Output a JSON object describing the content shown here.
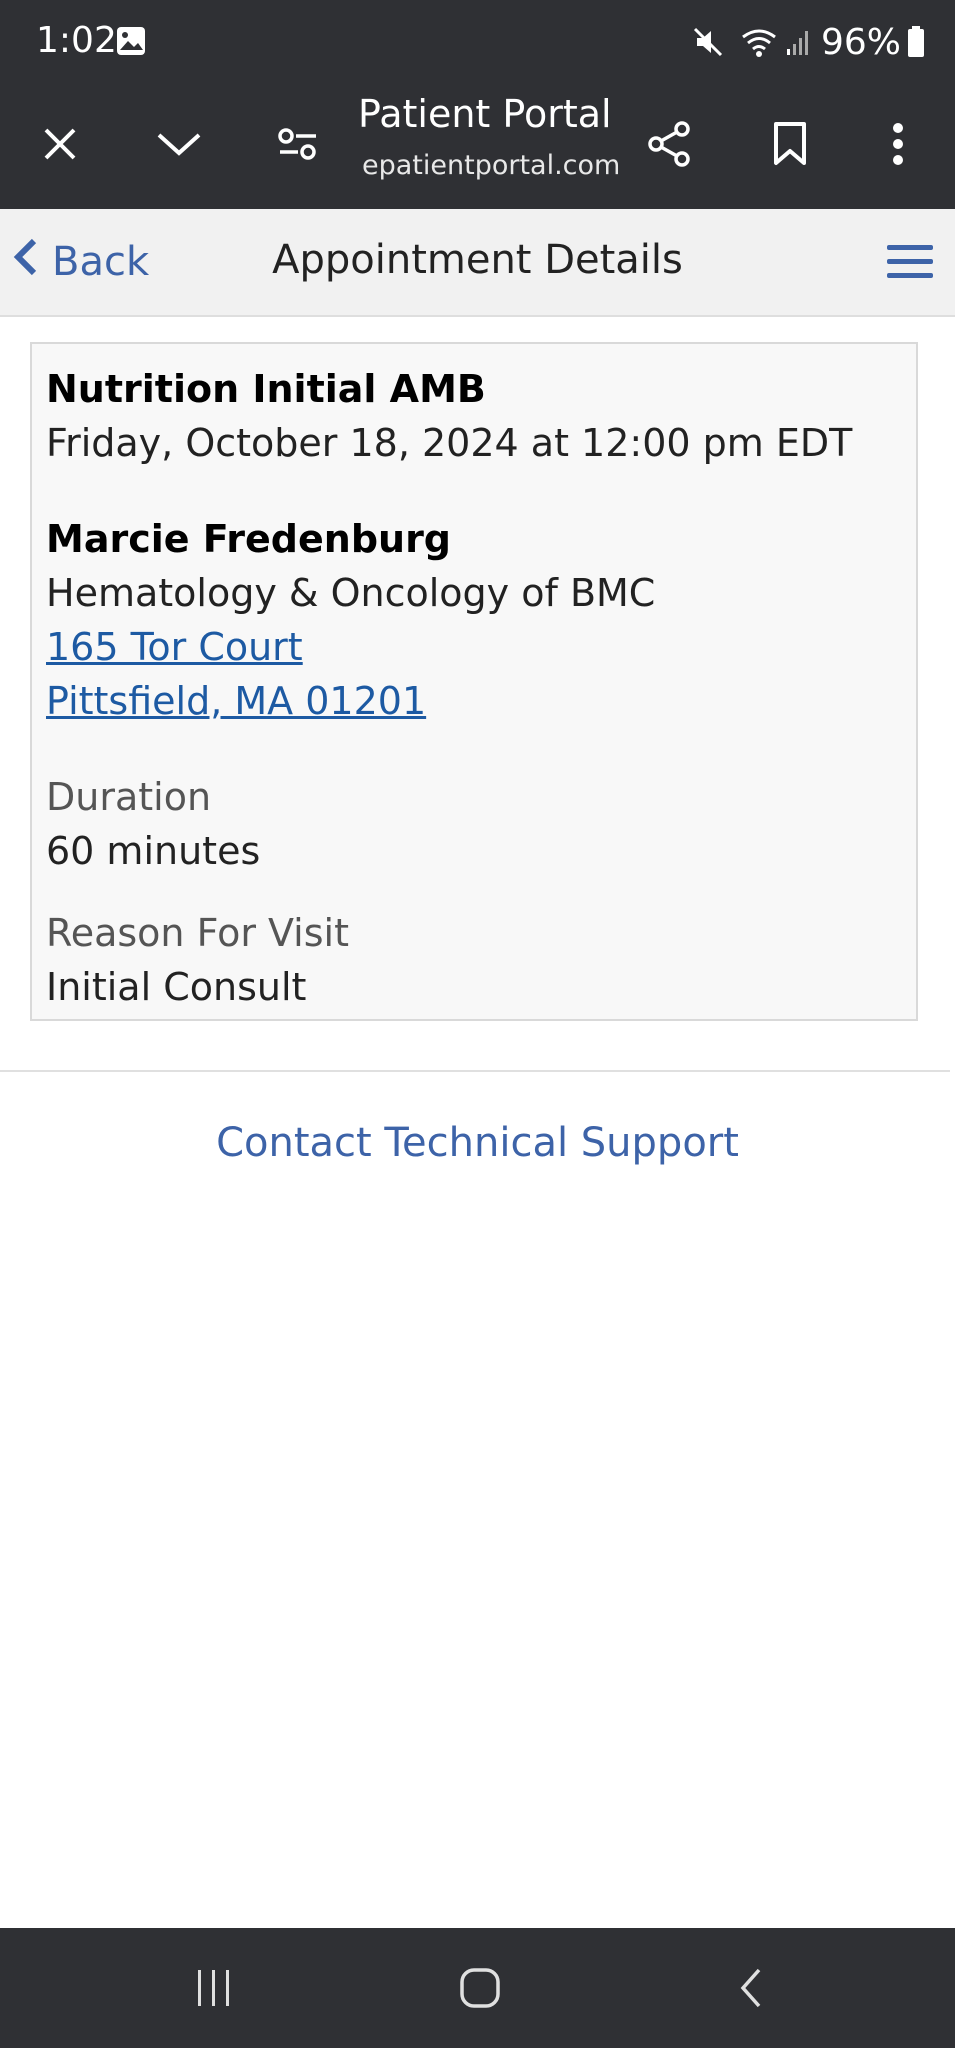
{
  "status_bar": {
    "time": "1:02",
    "battery": "96%",
    "icons": [
      "gallery-icon",
      "mute-icon",
      "wifi-icon",
      "signal-icon",
      "battery-icon"
    ]
  },
  "browser": {
    "title": "Patient Portal",
    "url": "epatientportal.com",
    "icons": [
      "close-icon",
      "chevron-down-icon",
      "settings-sliders-icon",
      "share-icon",
      "bookmark-icon",
      "more-vertical-icon"
    ]
  },
  "header": {
    "back_label": "Back",
    "title": "Appointment Details",
    "icons": [
      "chevron-left-icon",
      "hamburger-menu-icon"
    ]
  },
  "appointment": {
    "type": "Nutrition Initial AMB",
    "datetime": "Friday, October 18, 2024 at 12:00 pm EDT",
    "provider": "Marcie Fredenburg",
    "department": "Hematology & Oncology of BMC",
    "address_line1": "165 Tor Court",
    "address_line2": "Pittsfield, MA 01201",
    "duration_label": "Duration",
    "duration_value": "60 minutes",
    "reason_label": "Reason For Visit",
    "reason_value": "Initial Consult"
  },
  "footer": {
    "support_link": "Contact Technical Support"
  },
  "colors": {
    "system_bar": "#2f3034",
    "link_blue": "#1d5aa3",
    "accent_blue": "#3d63a8",
    "header_bg": "#f1f1f1"
  },
  "nav_icons": [
    "recents-icon",
    "home-icon",
    "back-icon"
  ]
}
